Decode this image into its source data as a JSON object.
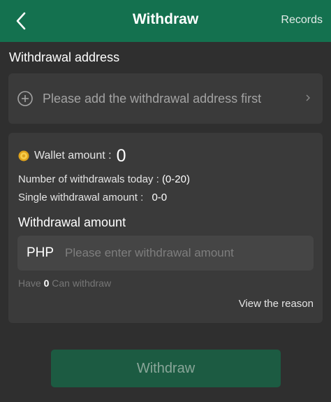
{
  "header": {
    "title": "Withdraw",
    "records_label": "Records",
    "back_icon": "chevron-left-icon"
  },
  "address_section": {
    "title": "Withdrawal address",
    "placeholder": "Please add the withdrawal address first",
    "add_icon": "plus-circle-icon",
    "arrow_icon": "chevron-right-icon"
  },
  "wallet": {
    "label": "Wallet amount :",
    "amount": "0",
    "coin_icon": "coin-icon"
  },
  "limits": {
    "today_label": "Number of withdrawals today :",
    "today_value": "(0-20)",
    "single_label": "Single withdrawal amount :",
    "single_value": "0-0"
  },
  "amount_section": {
    "title": "Withdrawal amount",
    "currency": "PHP",
    "placeholder": "Please enter withdrawal amount",
    "have_prefix": "Have",
    "have_count": "0",
    "have_suffix": "Can withdraw",
    "view_reason": "View the reason"
  },
  "submit": {
    "label": "Withdraw"
  },
  "colors": {
    "header_bg": "#14714f",
    "page_bg": "#2f2f2f",
    "card_bg": "#3a3a3a",
    "button_bg": "#1c5b42"
  }
}
